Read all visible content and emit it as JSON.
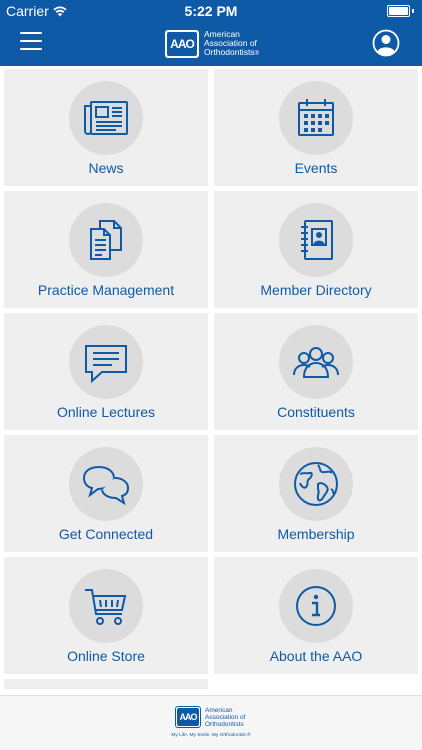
{
  "status_bar": {
    "carrier": "Carrier",
    "time": "5:22 PM"
  },
  "nav": {
    "logo_mark": "AAO",
    "logo_line1": "American",
    "logo_line2": "Association of",
    "logo_line3": "Orthodontists",
    "logo_reg": "®",
    "menu_icon": "hamburger-icon",
    "profile_icon": "user-profile-icon"
  },
  "tiles": [
    {
      "label": "News",
      "icon": "newspaper-icon"
    },
    {
      "label": "Events",
      "icon": "calendar-icon"
    },
    {
      "label": "Practice Management",
      "icon": "documents-icon"
    },
    {
      "label": "Member Directory",
      "icon": "address-book-icon"
    },
    {
      "label": "Online Lectures",
      "icon": "chat-bubble-icon"
    },
    {
      "label": "Constituents",
      "icon": "group-icon"
    },
    {
      "label": "Get Connected",
      "icon": "conversation-icon"
    },
    {
      "label": "Membership",
      "icon": "globe-icon"
    },
    {
      "label": "Online Store",
      "icon": "shopping-cart-icon"
    },
    {
      "label": "About the AAO",
      "icon": "info-icon"
    }
  ],
  "footer": {
    "logo_mark": "AAO",
    "logo_line1": "American",
    "logo_line2": "Association of",
    "logo_line3": "Orthodontists",
    "tagline": "My Life. My Smile. My Orthodontist.®"
  },
  "colors": {
    "brand": "#0f5aa6",
    "tile_bg": "#efefef",
    "circle_bg": "#dcdcdc"
  }
}
